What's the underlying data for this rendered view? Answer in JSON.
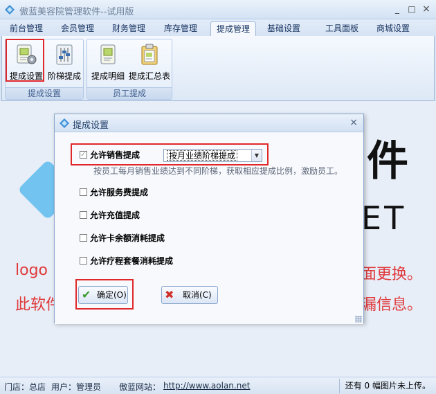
{
  "window": {
    "title": "傲蓝美容院管理软件--试用版",
    "min": "_",
    "max": "□",
    "close": "×"
  },
  "tabs": [
    {
      "label": "前台管理"
    },
    {
      "label": "会员管理"
    },
    {
      "label": "财务管理"
    },
    {
      "label": "库存管理"
    },
    {
      "label": "提成管理"
    },
    {
      "label": "基础设置"
    },
    {
      "label": "工具面板"
    },
    {
      "label": "商城设置"
    }
  ],
  "active_tab": "提成管理",
  "ribbon": {
    "group1": {
      "label": "提成设置",
      "buttons": [
        {
          "label": "提成设置"
        },
        {
          "label": "阶梯提成"
        }
      ]
    },
    "group2": {
      "label": "员工提成",
      "buttons": [
        {
          "label": "提成明细"
        },
        {
          "label": "提成汇总表"
        }
      ]
    }
  },
  "background": {
    "big_char": "件",
    "net_text": "ET",
    "red_line1_left": "logo",
    "red_line1_right": "面更换。",
    "red_line2_left": "此软件",
    "red_line2_right": "漏信息。"
  },
  "dialog": {
    "title": "提成设置",
    "close": "×",
    "options": [
      {
        "label": "允许销售提成",
        "checked": true
      },
      {
        "label": "允许服务费提成",
        "checked": false
      },
      {
        "label": "允许充值提成",
        "checked": false
      },
      {
        "label": "允许卡余额消耗提成",
        "checked": false
      },
      {
        "label": "允许疗程套餐消耗提成",
        "checked": false
      }
    ],
    "sales_mode": {
      "selected": "按月业绩阶梯提成"
    },
    "hint": "按员工每月销售业绩达到不同阶梯，获取相应提成比例，激励员工。",
    "ok_label": "确定(O)",
    "cancel_label": "取消(C)"
  },
  "status": {
    "store": "门店：总店",
    "user": "用户：管理员",
    "site_label": "傲蓝网站：",
    "site_url": "http://www.aolan.net",
    "right": "还有 0 幅图片未上传。"
  },
  "colors": {
    "highlight_red": "#e0282a",
    "accent_blue": "#73c3f0"
  }
}
